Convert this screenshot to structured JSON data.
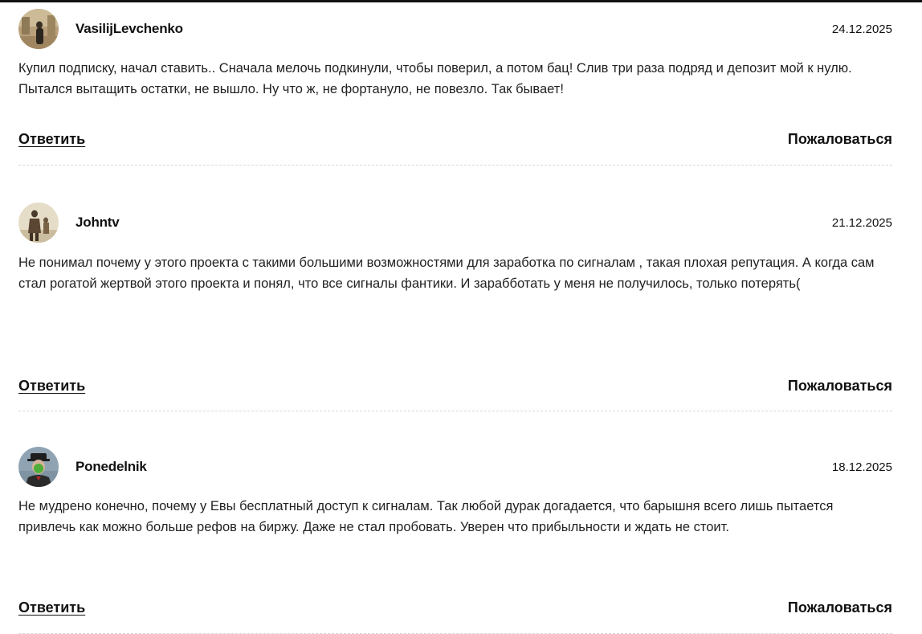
{
  "comments": [
    {
      "author": "VasilijLevchenko",
      "date": "24.12.2025",
      "text": "Купил подписку, начал ставить.. Сначала мелочь подкинули, чтобы поверил, а потом бац! Слив три раза подряд и депозит мой к нулю. Пытался вытащить остатки, не вышло. Ну что ж, не фортануло, не повезло. Так бывает!",
      "reply_label": "Ответить",
      "report_label": "Пожаловаться",
      "avatar_icon": "person-photo-avatar"
    },
    {
      "author": "Johntv",
      "date": "21.12.2025",
      "text": "Не понимал почему у этого проекта с такими большими возможностями для заработка по сигналам , такая плохая репутация. А когда сам стал рогатой жертвой этого проекта и понял, что все сигналы фантики. И зарабботать у меня не получилось, только потерять(",
      "reply_label": "Ответить",
      "report_label": "Пожаловаться",
      "avatar_icon": "figure-photo-avatar"
    },
    {
      "author": "Ponedelnik",
      "date": "18.12.2025",
      "text": "Не мудрено конечно, почему у Евы бесплатный доступ к сигналам. Так любой дурак догадается, что барышня всего лишь пытается привлечь как можно больше рефов на биржу. Даже не стал пробовать. Уверен что прибыльности и ждать не стоит.",
      "reply_label": "Ответить",
      "report_label": "Пожаловаться",
      "avatar_icon": "man-with-apple-avatar"
    }
  ]
}
